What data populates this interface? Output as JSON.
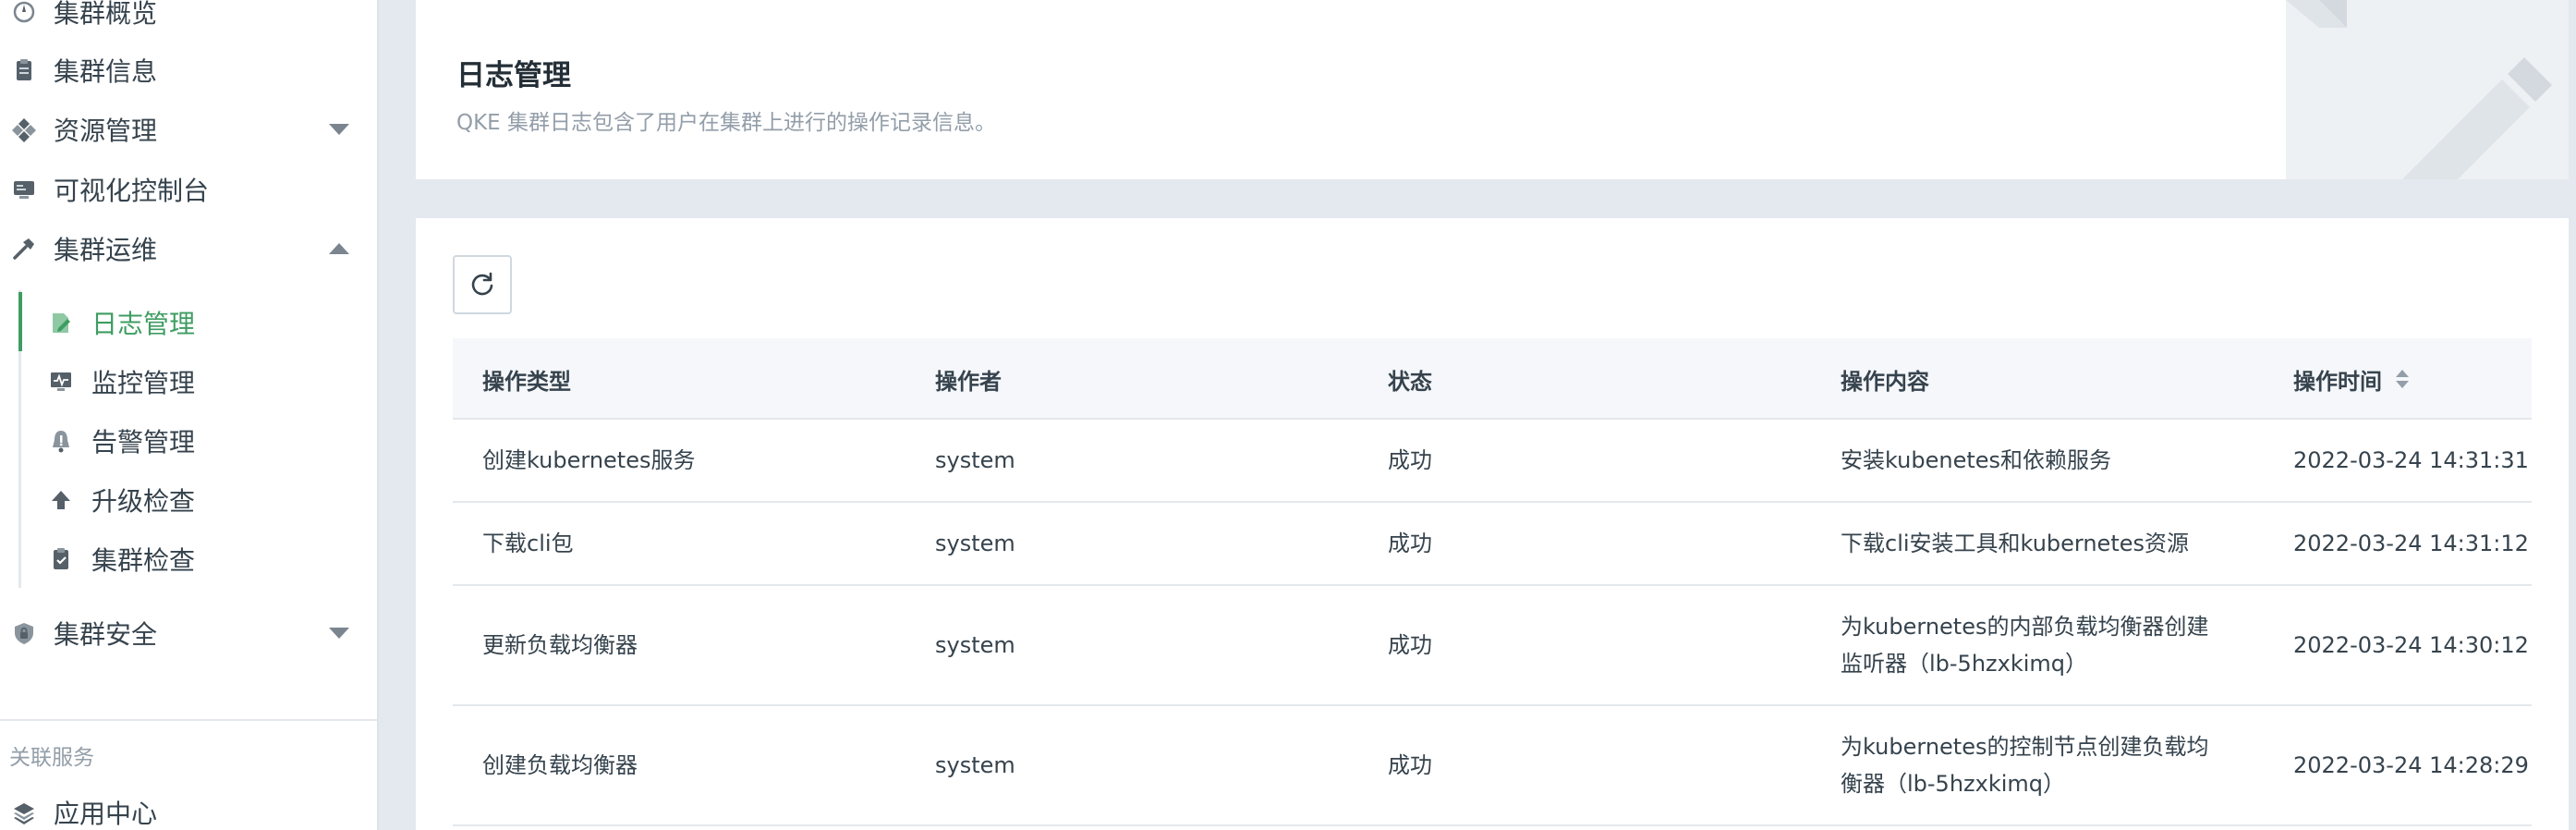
{
  "sidebar": {
    "items": [
      {
        "label": "集群概览",
        "icon": "dashboard-icon"
      },
      {
        "label": "集群信息",
        "icon": "clipboard-icon"
      },
      {
        "label": "资源管理",
        "icon": "cubes-icon",
        "caret": "down"
      },
      {
        "label": "可视化控制台",
        "icon": "console-icon"
      },
      {
        "label": "集群运维",
        "icon": "hammer-icon",
        "caret": "up"
      }
    ],
    "sub_items": [
      {
        "label": "日志管理",
        "icon": "log-icon",
        "active": true
      },
      {
        "label": "监控管理",
        "icon": "monitor-icon"
      },
      {
        "label": "告警管理",
        "icon": "alarm-icon"
      },
      {
        "label": "升级检查",
        "icon": "upgrade-icon"
      },
      {
        "label": "集群检查",
        "icon": "checklist-icon"
      }
    ],
    "security": {
      "label": "集群安全",
      "icon": "shield-icon",
      "caret": "down"
    },
    "section_label": "关联服务",
    "app_center": {
      "label": "应用中心",
      "icon": "layers-icon"
    }
  },
  "header": {
    "title": "日志管理",
    "description": "QKE 集群日志包含了用户在集群上进行的操作记录信息。"
  },
  "toolbar": {
    "refresh_icon": "refresh-icon"
  },
  "table": {
    "columns": [
      "操作类型",
      "操作者",
      "状态",
      "操作内容",
      "操作时间"
    ],
    "rows": [
      {
        "type": "创建kubernetes服务",
        "operator": "system",
        "status": "成功",
        "content": "安装kubenetes和依赖服务",
        "time": "2022-03-24 14:31:31"
      },
      {
        "type": "下载cli包",
        "operator": "system",
        "status": "成功",
        "content": "下载cli安装工具和kubernetes资源",
        "time": "2022-03-24 14:31:12"
      },
      {
        "type": "更新负载均衡器",
        "operator": "system",
        "status": "成功",
        "content": "为kubernetes的内部负载均衡器创建监听器（lb-5hzxkimq）",
        "time": "2022-03-24 14:30:12"
      },
      {
        "type": "创建负载均衡器",
        "operator": "system",
        "status": "成功",
        "content": "为kubernetes的控制节点创建负载均衡器（lb-5hzxkimq）",
        "time": "2022-03-24 14:28:29"
      }
    ]
  },
  "colors": {
    "accent": "#3e9d62",
    "text": "#36434d",
    "muted": "#939ea9",
    "background": "#e4e9ef"
  }
}
